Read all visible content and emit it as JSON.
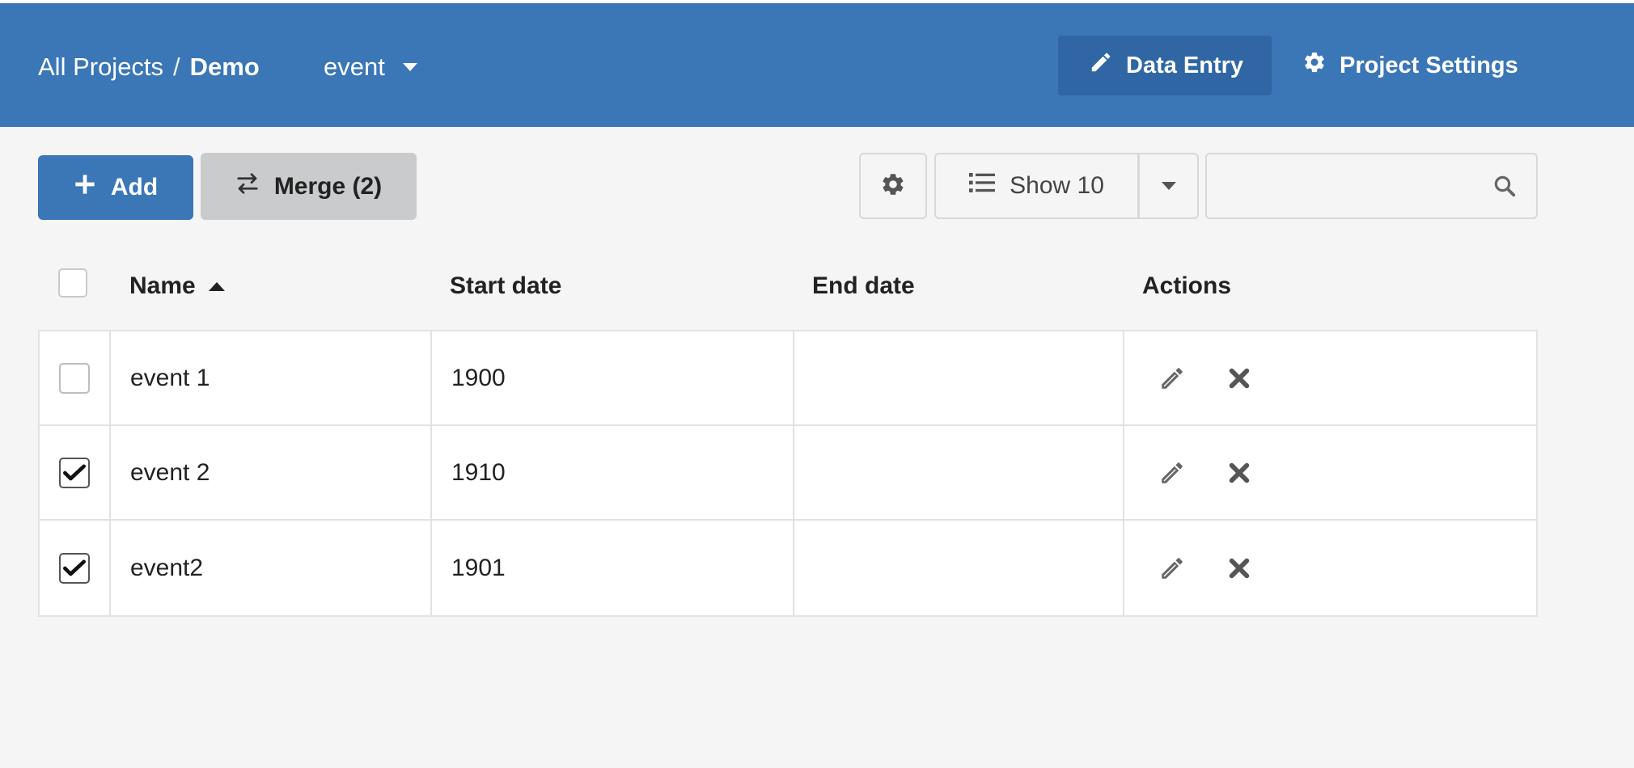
{
  "navbar": {
    "breadcrumb_root": "All Projects",
    "breadcrumb_separator": "/",
    "breadcrumb_current": "Demo",
    "entity_type": "event",
    "tabs": [
      {
        "label": "Data Entry",
        "icon": "pencil-icon",
        "active": true
      },
      {
        "label": "Project Settings",
        "icon": "gear-icon",
        "active": false
      }
    ],
    "bg_color": "#3b76b6"
  },
  "toolbar": {
    "add_label": "Add",
    "merge_label": "Merge (2)",
    "show_label": "Show 10",
    "search_value": "",
    "search_placeholder": ""
  },
  "table": {
    "columns": [
      "Name",
      "Start date",
      "End date",
      "Actions"
    ],
    "sort_column": "Name",
    "sort_direction": "ascending",
    "rows": [
      {
        "checked": false,
        "name": "event 1",
        "start": "1900",
        "end": ""
      },
      {
        "checked": true,
        "name": "event 2",
        "start": "1910",
        "end": ""
      },
      {
        "checked": true,
        "name": "event2",
        "start": "1901",
        "end": ""
      }
    ]
  }
}
